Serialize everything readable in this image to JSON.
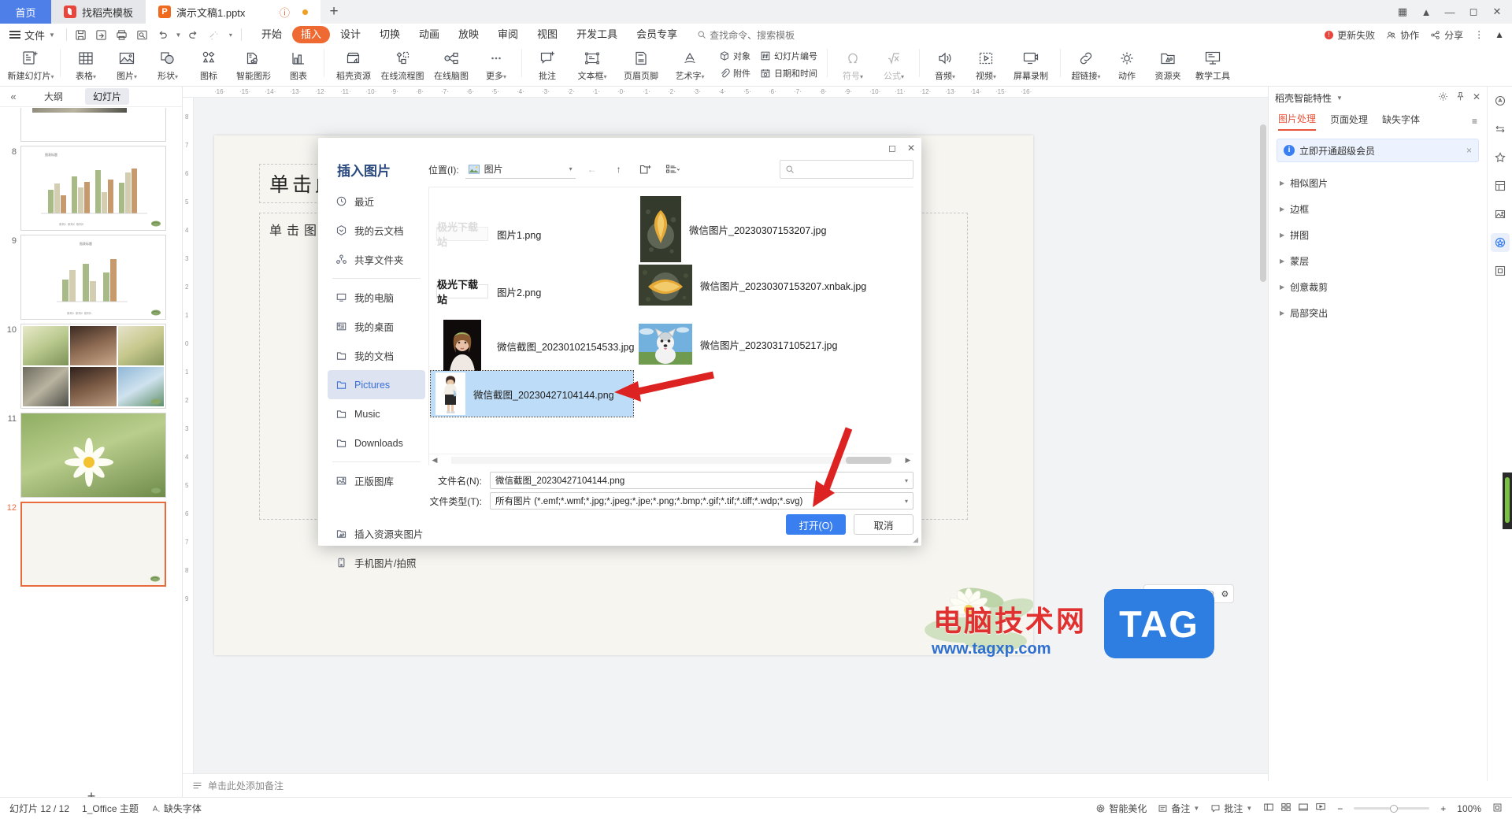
{
  "window": {
    "tabs": [
      {
        "label": "首页",
        "icon": "home-icon"
      },
      {
        "label": "找稻壳模板",
        "icon": "docer-icon"
      },
      {
        "label": "演示文稿1.pptx",
        "icon": "ppt-icon"
      }
    ],
    "new_tab_label": "+",
    "controls": [
      "restore-icon",
      "minimize",
      "maximize",
      "close"
    ]
  },
  "menu": {
    "file_label": "文件",
    "quick_access": [
      "save-icon",
      "save-as-icon",
      "print-icon",
      "print-preview-icon",
      "undo-icon",
      "redo-icon",
      "format-painter-icon",
      "customize-icon"
    ],
    "ribbon_tabs": [
      "开始",
      "插入",
      "设计",
      "切换",
      "动画",
      "放映",
      "审阅",
      "视图",
      "开发工具",
      "会员专享"
    ],
    "active_ribbon_tab": "插入",
    "search_placeholder": "查找命令、搜索模板",
    "right_items": [
      "更新失败",
      "协作",
      "分享"
    ],
    "update_badge": "!"
  },
  "ribbon": {
    "items": [
      {
        "label": "新建幻灯片",
        "icon": "new-slide-icon",
        "dropdown": true
      },
      {
        "label": "表格",
        "icon": "table-icon",
        "dropdown": true
      },
      {
        "label": "图片",
        "icon": "picture-icon",
        "dropdown": true
      },
      {
        "label": "形状",
        "icon": "shape-icon",
        "dropdown": true
      },
      {
        "label": "图标",
        "icon": "icons-icon",
        "dropdown": false
      },
      {
        "label": "智能图形",
        "icon": "smartart-icon",
        "dropdown": false
      },
      {
        "label": "图表",
        "icon": "chart-icon",
        "dropdown": false
      },
      {
        "label": "稻壳资源",
        "icon": "docer-resource-icon",
        "dropdown": false
      },
      {
        "label": "在线流程图",
        "icon": "flowchart-icon",
        "dropdown": false
      },
      {
        "label": "在线脑图",
        "icon": "mindmap-icon",
        "dropdown": false
      },
      {
        "label": "更多",
        "icon": "more-icon",
        "dropdown": true
      },
      {
        "label": "批注",
        "icon": "comment-icon",
        "dropdown": false
      },
      {
        "label": "文本框",
        "icon": "textbox-icon",
        "dropdown": true
      },
      {
        "label": "页眉页脚",
        "icon": "header-footer-icon",
        "dropdown": false
      },
      {
        "label": "艺术字",
        "icon": "wordart-icon",
        "dropdown": true
      }
    ],
    "small_items": [
      {
        "label": "对象",
        "icon": "object-icon"
      },
      {
        "label": "附件",
        "icon": "attachment-icon"
      },
      {
        "label": "幻灯片编号",
        "icon": "slide-number-icon"
      },
      {
        "label": "日期和时间",
        "icon": "datetime-icon"
      }
    ],
    "items2": [
      {
        "label": "符号",
        "icon": "symbol-icon",
        "dropdown": true,
        "disabled": true
      },
      {
        "label": "公式",
        "icon": "formula-icon",
        "dropdown": true,
        "disabled": true
      },
      {
        "label": "音频",
        "icon": "audio-icon",
        "dropdown": true
      },
      {
        "label": "视频",
        "icon": "video-icon",
        "dropdown": true
      },
      {
        "label": "屏幕录制",
        "icon": "screen-record-icon",
        "dropdown": false
      },
      {
        "label": "超链接",
        "icon": "hyperlink-icon",
        "dropdown": true
      },
      {
        "label": "动作",
        "icon": "action-icon",
        "dropdown": false
      },
      {
        "label": "资源夹",
        "icon": "resource-folder-icon",
        "dropdown": false
      },
      {
        "label": "教学工具",
        "icon": "teaching-tools-icon",
        "dropdown": false
      }
    ]
  },
  "left_panel": {
    "collapse_icon": "collapse-icon",
    "tabs": [
      {
        "label": "大纲"
      },
      {
        "label": "幻灯片"
      }
    ],
    "active_tab": "幻灯片",
    "slides": [
      {
        "number": "8"
      },
      {
        "number": "9"
      },
      {
        "number": "10"
      },
      {
        "number": "11"
      },
      {
        "number": "12"
      }
    ],
    "selected_slide": "12",
    "add_slide_label": "+"
  },
  "canvas": {
    "title_placeholder": "单击此处添加标题",
    "body_placeholder": "单击图标添加内容",
    "ruler_marks": [
      "16",
      "15",
      "14",
      "13",
      "12",
      "11",
      "10",
      "9",
      "8",
      "7",
      "6",
      "5",
      "4",
      "3",
      "2",
      "1",
      "0",
      "1",
      "2",
      "3",
      "4",
      "5",
      "6",
      "7",
      "8",
      "9",
      "10",
      "11",
      "12",
      "13",
      "14",
      "15",
      "16"
    ],
    "ruler_marks_v": [
      "8",
      "7",
      "6",
      "5",
      "4",
      "3",
      "2",
      "1",
      "0",
      "1",
      "2",
      "3",
      "4",
      "5",
      "6",
      "7",
      "8",
      "9"
    ]
  },
  "right_panel": {
    "title": "稻壳智能特性",
    "header_icons": [
      "gear-icon",
      "pin-icon",
      "close-icon"
    ],
    "tabs": [
      "图片处理",
      "页面处理",
      "缺失字体"
    ],
    "active_tab": "图片处理",
    "more_icon": "more-icon",
    "banner": {
      "text": "立即开通超级会员",
      "icon": "info-icon",
      "close": "×"
    },
    "sections": [
      "相似图片",
      "边框",
      "拼图",
      "蒙层",
      "创意裁剪",
      "局部突出"
    ],
    "rail_icons": [
      "ai-icon",
      "resize-icon",
      "star-icon",
      "layout-icon",
      "image-icon",
      "magic-icon",
      "frame-icon"
    ]
  },
  "dialog": {
    "heading": "插入图片",
    "window_buttons": [
      "maximize-icon",
      "close-icon"
    ],
    "location_label": "位置(I):",
    "location_value": "图片",
    "nav": [
      "back-icon",
      "up-icon",
      "new-folder-icon",
      "view-mode-icon"
    ],
    "search_placeholder": "",
    "sidebar": [
      {
        "label": "最近",
        "icon": "clock-icon"
      },
      {
        "label": "我的云文档",
        "icon": "cloud-icon"
      },
      {
        "label": "共享文件夹",
        "icon": "share-icon"
      },
      {
        "label": "我的电脑",
        "icon": "computer-icon"
      },
      {
        "label": "我的桌面",
        "icon": "desktop-icon"
      },
      {
        "label": "我的文档",
        "icon": "folder-icon"
      },
      {
        "label": "Pictures",
        "icon": "folder-icon"
      },
      {
        "label": "Music",
        "icon": "folder-icon"
      },
      {
        "label": "Downloads",
        "icon": "folder-icon"
      },
      {
        "label": "正版图库",
        "icon": "gallery-icon"
      },
      {
        "label": "插入资源夹图片",
        "icon": "resource-folder-icon"
      },
      {
        "label": "手机图片/拍照",
        "icon": "phone-icon"
      }
    ],
    "sidebar_selected": "Pictures",
    "files": [
      {
        "name": "图片1.png",
        "thumb": "watermark-light"
      },
      {
        "name": "微信图片_20230307153207.jpg",
        "thumb": "leaf-dark"
      },
      {
        "name": "图片2.png",
        "thumb": "watermark-bold"
      },
      {
        "name": "微信图片_20230307153207.xnbak.jpg",
        "thumb": "leaf-dark"
      },
      {
        "name": "微信截图_20230102154533.jpg",
        "thumb": "portrait"
      },
      {
        "name": "微信图片_20230317105217.jpg",
        "thumb": "husky"
      },
      {
        "name": "微信截图_20230427104144.png",
        "thumb": "person-white",
        "selected": true
      }
    ],
    "watermark_light_text": "极光下载站",
    "watermark_bold_text": "极光下载站",
    "filename_label": "文件名(N):",
    "filename_value": "微信截图_20230427104144.png",
    "filetype_label": "文件类型(T):",
    "filetype_value": "所有图片 (*.emf;*.wmf;*.jpg;*.jpeg;*.jpe;*.png;*.bmp;*.gif;*.tif;*.tiff;*.wdp;*.svg)",
    "open_button": "打开(O)",
    "cancel_button": "取消"
  },
  "notes": {
    "placeholder": "单击此处添加备注",
    "icon": "notes-icon"
  },
  "status": {
    "slide_count": "幻灯片 12 / 12",
    "theme": "1_Office 主题",
    "missing_font": "缺失字体",
    "beautify": "智能美化",
    "notes_btn": "备注",
    "comment_btn": "批注",
    "zoom_value": "100%",
    "view_icons": [
      "normal-view-icon",
      "sorter-view-icon",
      "reading-view-icon",
      "slideshow-icon"
    ]
  },
  "watermarks": {
    "tag": "TAG",
    "site_name": "电脑技术网",
    "site_url": "www.tagxp.com"
  },
  "colors": {
    "accent_orange": "#ef6a33",
    "accent_blue": "#3a7ff0",
    "home_tab_blue": "#4e7fe8",
    "selected_file_blue": "#bddcf7",
    "arrow_red": "#e02020"
  }
}
